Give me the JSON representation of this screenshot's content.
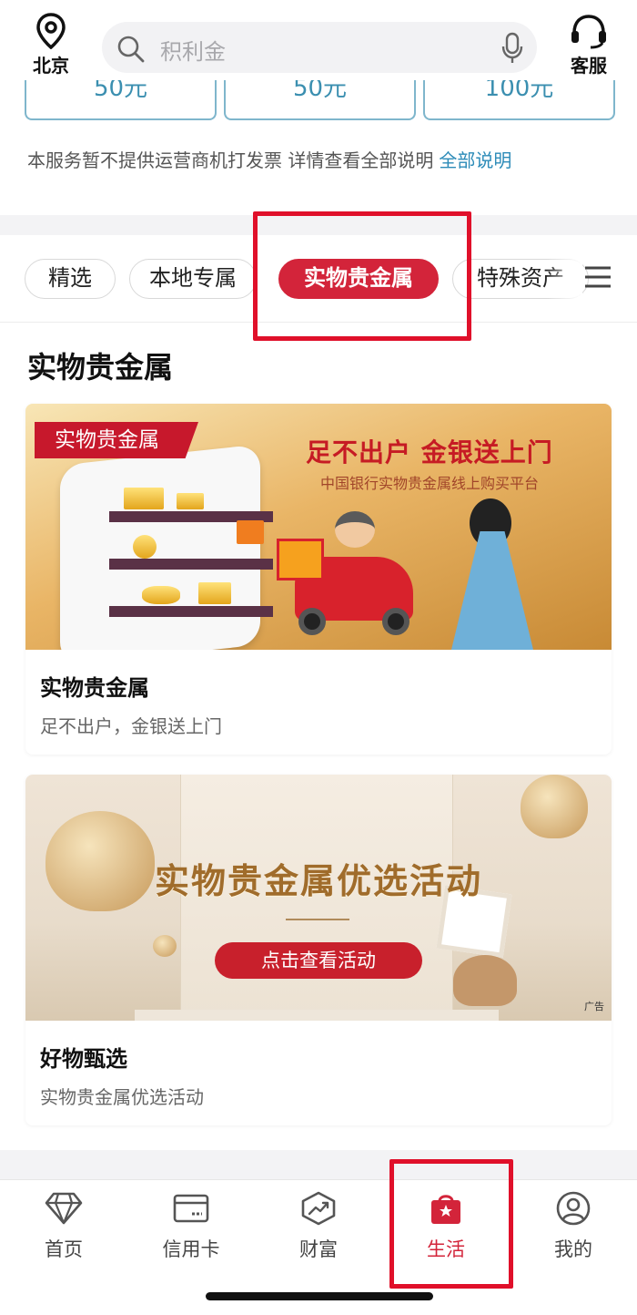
{
  "header": {
    "location": "北京",
    "search_placeholder": "积利金",
    "service": "客服"
  },
  "top_cards": [
    "50元",
    "50元",
    "100元"
  ],
  "notice": {
    "text": "本服务暂不提供运营商机打发票 详情查看全部说明",
    "link": "全部说明"
  },
  "tabs": [
    {
      "label": "精选",
      "active": false
    },
    {
      "label": "本地专属",
      "active": false
    },
    {
      "label": "实物贵金属",
      "active": true
    },
    {
      "label": "特殊资产",
      "active": false
    }
  ],
  "section": {
    "title": "实物贵金属",
    "cards": [
      {
        "banner_tag": "实物贵金属",
        "banner_headline": "足不出户  金银送上门",
        "banner_subline": "中国银行实物贵金属线上购买平台",
        "title": "实物贵金属",
        "subtitle": "足不出户，金银送上门"
      },
      {
        "banner_headline": "实物贵金属优选活动",
        "banner_button": "点击查看活动",
        "banner_ad": "广告",
        "title": "好物甄选",
        "subtitle": "实物贵金属优选活动"
      }
    ]
  },
  "nav": [
    {
      "label": "首页",
      "icon": "diamond-icon",
      "active": false
    },
    {
      "label": "信用卡",
      "icon": "credit-card-icon",
      "active": false
    },
    {
      "label": "财富",
      "icon": "wealth-chart-icon",
      "active": false
    },
    {
      "label": "生活",
      "icon": "shopping-bag-icon",
      "active": true
    },
    {
      "label": "我的",
      "icon": "user-icon",
      "active": false
    }
  ],
  "colors": {
    "accent": "#d3243a",
    "highlight_box": "#e0102a",
    "link": "#2c8bb8"
  }
}
